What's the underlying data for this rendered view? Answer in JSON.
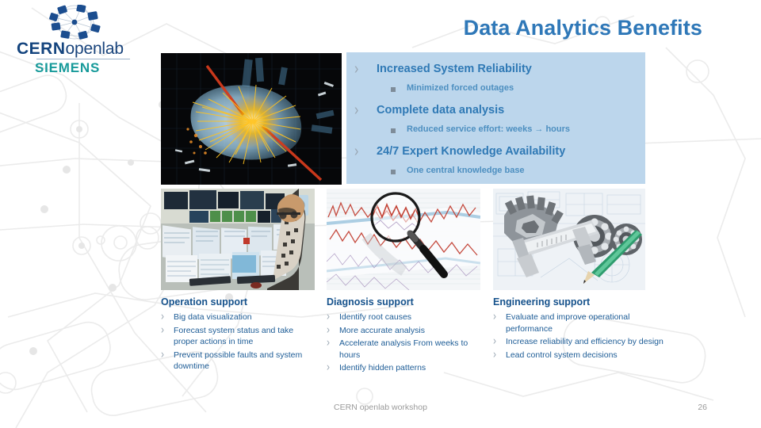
{
  "slide": {
    "title": "Data Analytics Benefits",
    "background_icon": "network-node-pattern"
  },
  "logo": {
    "mark_icon": "cern-openlab-network-logo",
    "cern": "CERN",
    "openlab": "openlab",
    "siemens": "SIEMENS",
    "cern_color": "#14447e",
    "siemens_color": "#179a9a"
  },
  "hero": {
    "image_icon": "particle-collision-event-display",
    "alt": "LHC particle collision event display"
  },
  "benefits": {
    "panel_color": "#bcd6ec",
    "items": [
      {
        "label": "Increased System Reliability",
        "marker_icon": "chevron-right-icon",
        "sub": [
          {
            "label": "Minimized forced outages",
            "marker_icon": "square-bullet-icon"
          }
        ]
      },
      {
        "label": "Complete data analysis",
        "marker_icon": "chevron-right-icon",
        "sub": [
          {
            "label": "Reduced service effort: weeks → hours",
            "marker_icon": "square-bullet-icon"
          }
        ]
      },
      {
        "label": "24/7 Expert Knowledge Availability",
        "marker_icon": "chevron-right-icon",
        "sub": [
          {
            "label": "One central knowledge base",
            "marker_icon": "square-bullet-icon"
          }
        ]
      }
    ]
  },
  "photos": [
    {
      "icon": "control-room-photo",
      "alt": "Operator in a control room with many monitors"
    },
    {
      "icon": "magnifier-chart-photo",
      "alt": "Magnifying glass over a paper strip chart recording"
    },
    {
      "icon": "engineering-parts-photo",
      "alt": "Gear, bearings, calipers and pencil on blueprints"
    }
  ],
  "columns": [
    {
      "heading": "Operation support",
      "items": [
        "Big data visualization",
        "Forecast system status and take proper actions in time",
        "Prevent possible faults and system downtime"
      ]
    },
    {
      "heading": "Diagnosis support",
      "items": [
        "Identify root causes",
        "More accurate analysis",
        "Accelerate analysis From weeks to hours",
        "Identify hidden patterns"
      ]
    },
    {
      "heading": "Engineering support",
      "items": [
        "Evaluate and improve operational performance",
        "Increase reliability and efficiency by design",
        "Lead control system decisions"
      ]
    }
  ],
  "footer": {
    "label": "CERN openlab workshop",
    "page": "26"
  }
}
